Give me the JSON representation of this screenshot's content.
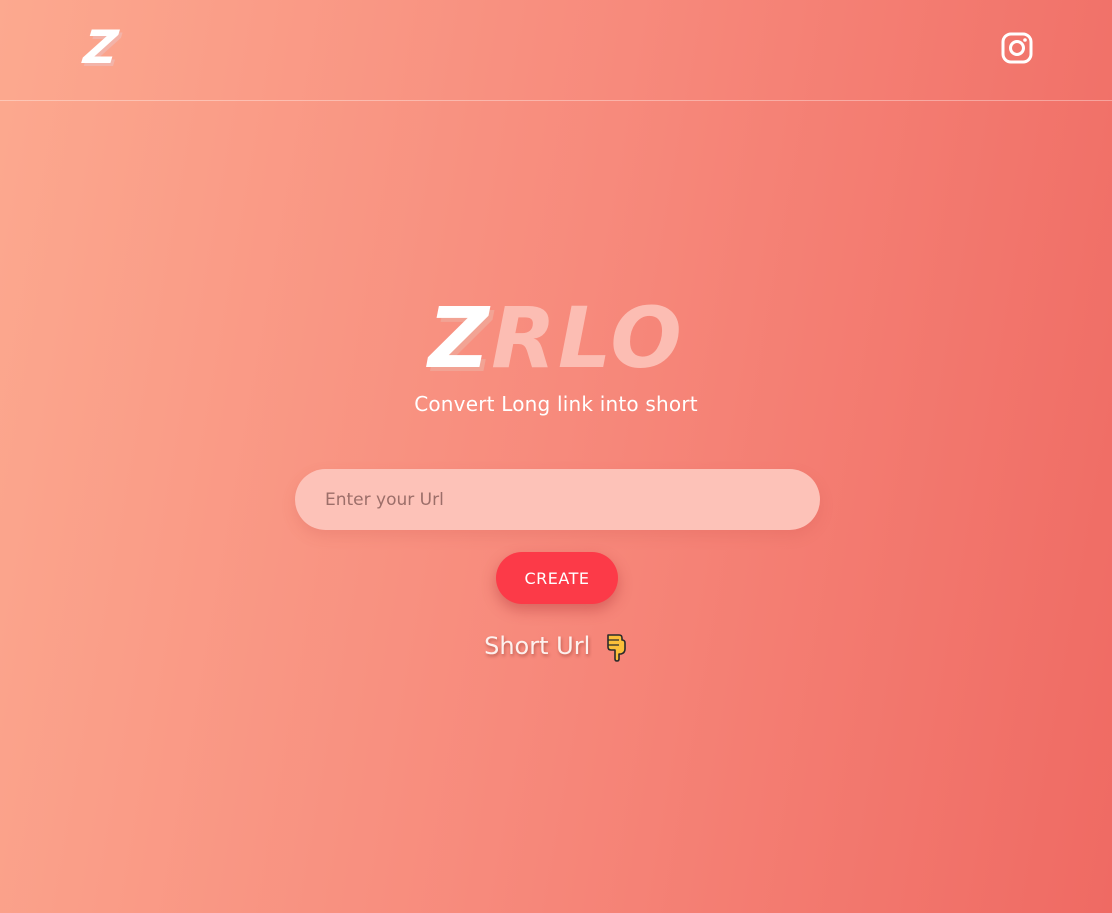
{
  "nav": {
    "logo_text": "Z",
    "instagram_icon": "instagram-icon"
  },
  "hero": {
    "brand_first": "Z",
    "brand_rest": "RLO",
    "tagline": "Convert Long link into short"
  },
  "form": {
    "url_placeholder": "Enter your Url",
    "url_value": "",
    "create_label": "CREATE"
  },
  "result": {
    "label": "Short Url",
    "pointer_icon": "pointing-down-hand-icon"
  },
  "colors": {
    "gradient_start": "#fca98f",
    "gradient_end": "#ef6a63",
    "button": "#fc3a48",
    "input_bg": "#fdc2b8",
    "brand_light": "#fcbdb3"
  }
}
